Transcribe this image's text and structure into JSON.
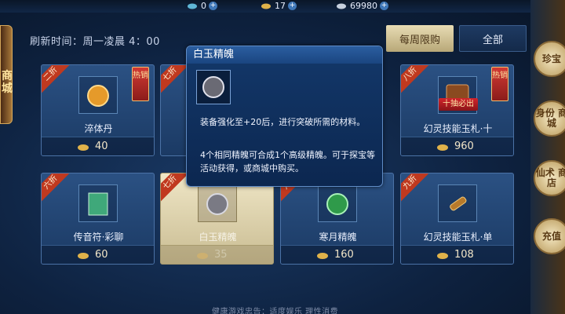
{
  "currencies": [
    {
      "value": "0"
    },
    {
      "value": "17"
    },
    {
      "value": "69980"
    }
  ],
  "refresh_text": "刷新时间：周一凌晨 4：00",
  "tabs": {
    "weekly": "每周限购",
    "all": "全部"
  },
  "items": [
    {
      "name": "淬体丹",
      "price": "40",
      "discount": "二折",
      "hot": "热销"
    },
    {
      "name": "幻灵技能玉札·十",
      "price": "960",
      "discount": "八折",
      "hot": "热销",
      "chip": "十抽必出"
    },
    {
      "name": "传音符·彩聊",
      "price": "60",
      "discount": "六折"
    },
    {
      "name": "白玉精魄",
      "price": "35",
      "discount": "七折"
    },
    {
      "name": "寒月精魄",
      "price": "160",
      "discount": "六折"
    },
    {
      "name": "幻灵技能玉札·单",
      "price": "108",
      "discount": "九折"
    }
  ],
  "hidden_card_discount": "七折",
  "tooltip": {
    "title": "白玉精魄",
    "desc1": "装备强化至+20后，进行突破所需的材料。",
    "desc2": "4个相同精魄可合成1个高级精魄。可于探宝等活动获得，或商城中购买。"
  },
  "right_buttons": [
    {
      "label": "珍宝"
    },
    {
      "label": "身份 商城"
    },
    {
      "label": "仙术 商店"
    },
    {
      "label": "充值"
    }
  ],
  "left_tab_label": "商城",
  "footer": "健康游戏忠告：适度娱乐 理性消费"
}
